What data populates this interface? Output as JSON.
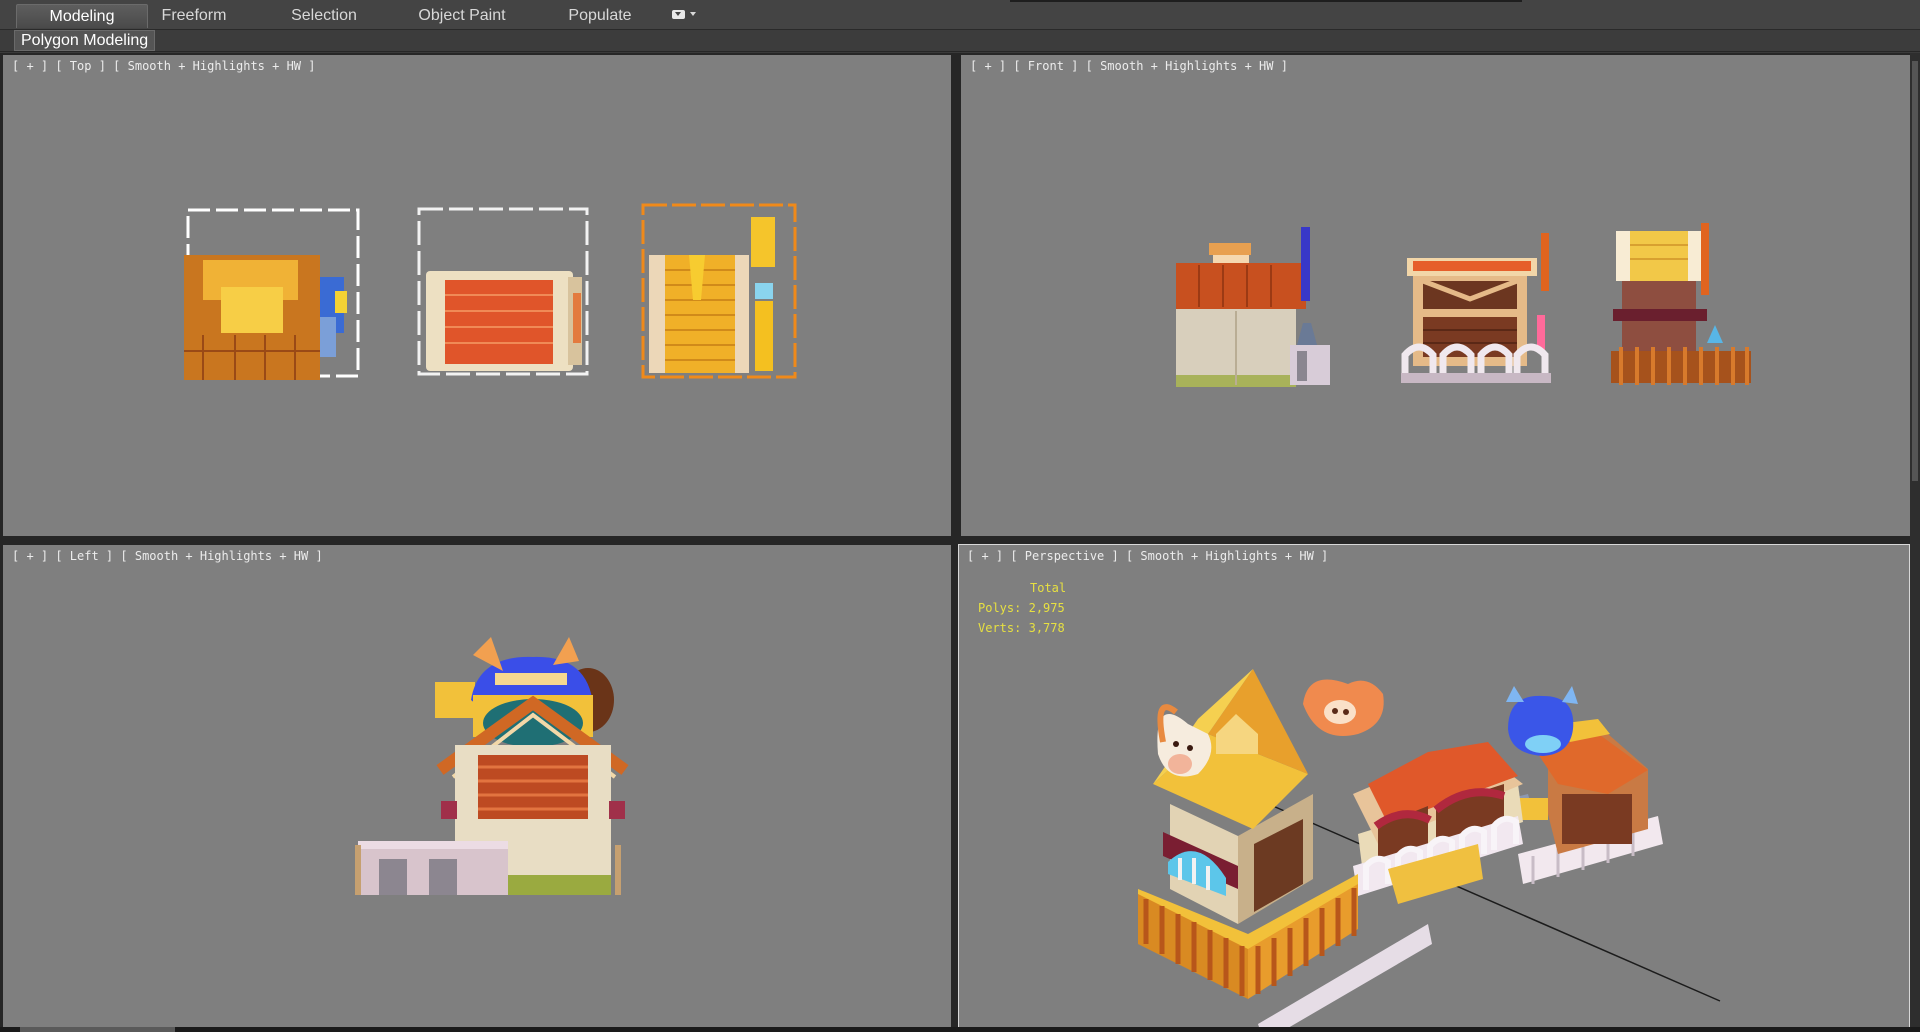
{
  "ribbon": {
    "tabs": [
      {
        "label": "Modeling",
        "active": true
      },
      {
        "label": "Freeform",
        "active": false
      },
      {
        "label": "Selection",
        "active": false
      },
      {
        "label": "Object Paint",
        "active": false
      },
      {
        "label": "Populate",
        "active": false
      }
    ],
    "options_icon": "dropdown-toggle-icon",
    "panel_label": "Polygon Modeling"
  },
  "viewports": {
    "top": {
      "plus": "[ + ]",
      "view": "[ Top ]",
      "shading": "[ Smooth + Highlights + HW ]"
    },
    "front": {
      "plus": "[ + ]",
      "view": "[ Front ]",
      "shading": "[ Smooth + Highlights + HW ]"
    },
    "left": {
      "plus": "[ + ]",
      "view": "[ Left ]",
      "shading": "[ Smooth + Highlights + HW ]"
    },
    "perspective": {
      "plus": "[ + ]",
      "view": "[ Perspective ]",
      "shading": "[ Smooth + Highlights + HW ]",
      "stats": {
        "total_label": "Total",
        "polys_label": "Polys:",
        "polys_value": "2,975",
        "verts_label": "Verts:",
        "verts_value": "3,778"
      }
    }
  },
  "colors": {
    "viewport_bg": "#7f7f7f",
    "stats_text": "#e7e041",
    "roof_orange": "#e0642c",
    "straw_yellow": "#f3c23a",
    "wall_cream": "#e8dcc0",
    "wood_brown": "#7a3f22",
    "fence_white": "#f2eef2"
  }
}
